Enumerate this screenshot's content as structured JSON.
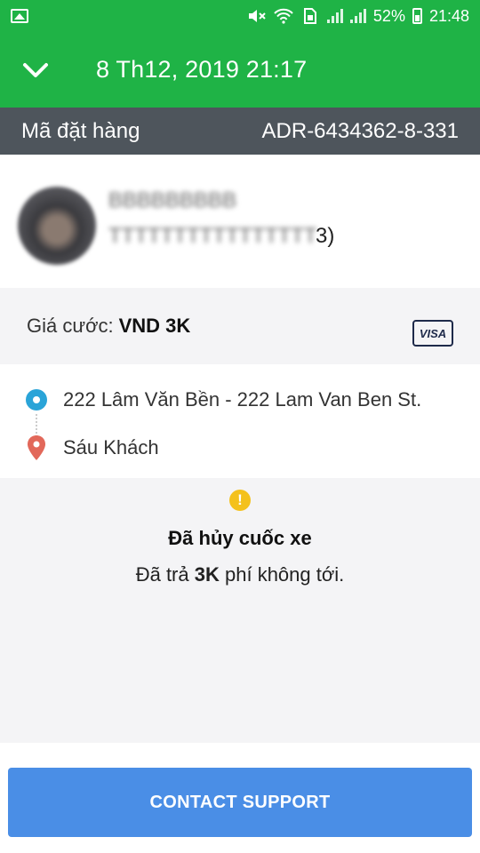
{
  "status_bar": {
    "battery": "52%",
    "time": "21:48",
    "icons": [
      "gallery-icon",
      "mute-icon",
      "wifi-icon",
      "sim-icon",
      "signal-icon",
      "signal-icon",
      "battery-icon"
    ]
  },
  "header": {
    "title": "8 Th12, 2019 21:17",
    "back_icon": "chevron-down-icon"
  },
  "order": {
    "label": "Mã đặt hàng",
    "value": "ADR-6434362-8-331"
  },
  "driver": {
    "name_blurred": "BBBBBBBBB",
    "vehicle_blurred": "TTTTTTTTTTTTTTTT",
    "suffix": "3)"
  },
  "fare": {
    "label": "Giá cước:",
    "amount": "VND 3K",
    "payment": "VISA"
  },
  "route": {
    "pickup": "222 Lâm Văn Bền - 222 Lam Van Ben St.",
    "dropoff": "Sáu Khách"
  },
  "booking_status": {
    "icon": "!",
    "headline": "Đã hủy cuốc xe",
    "desc_prefix": "Đã trả",
    "desc_amount": "3K",
    "desc_suffix": "phí không tới."
  },
  "actions": {
    "support": "CONTACT SUPPORT"
  },
  "colors": {
    "brand_green": "#1fb346",
    "order_bar": "#4e555c",
    "button_blue": "#4a8ee6",
    "pickup": "#2aa4d8",
    "dropoff": "#e2685a",
    "warning": "#f4c11c"
  }
}
